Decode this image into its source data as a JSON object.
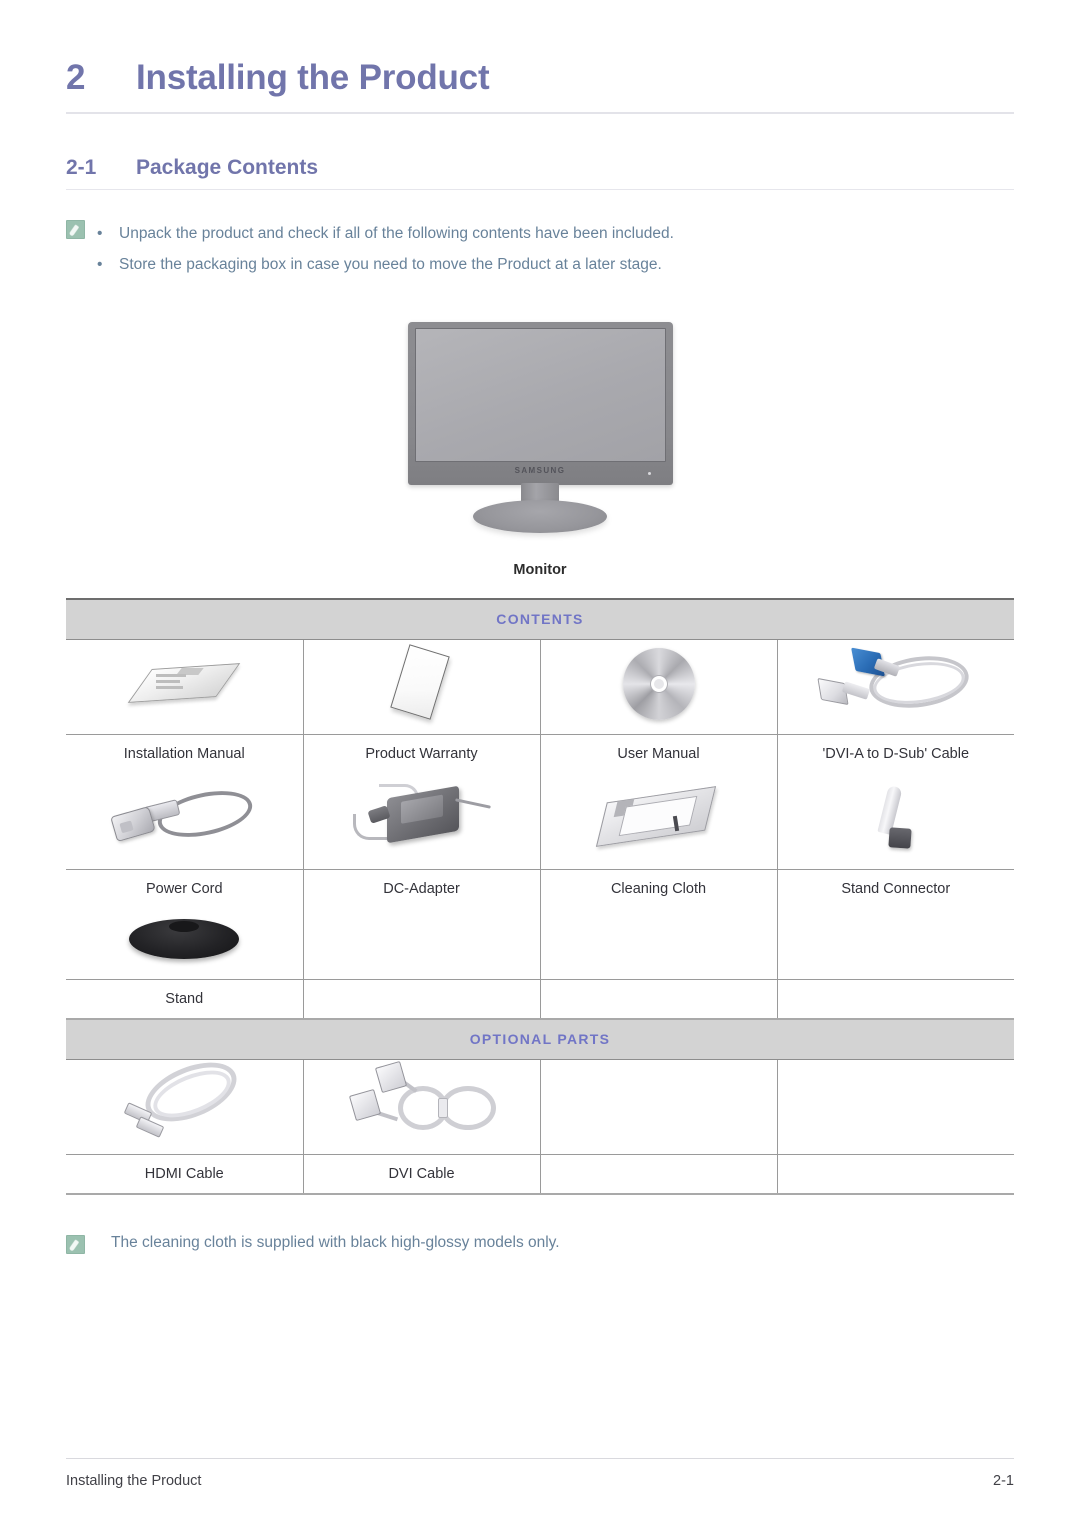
{
  "chapter": {
    "number": "2",
    "title": "Installing the Product"
  },
  "section": {
    "number": "2-1",
    "title": "Package Contents"
  },
  "notes": {
    "icon": "note-pencil-icon",
    "bullet": "•",
    "items": [
      "Unpack the product and check if all of the following contents have been included.",
      "Store the packaging box in case you need to move the Product at a later stage."
    ]
  },
  "figure": {
    "caption": "Monitor",
    "brand": "SAMSUNG",
    "alt": "monitor-illustration"
  },
  "table": {
    "contents_header": "CONTENTS",
    "optional_header": "OPTIONAL PARTS",
    "contents_rows": [
      [
        {
          "label": "Installation Manual",
          "icon": "installation-manual-icon"
        },
        {
          "label": "Product Warranty",
          "icon": "product-warranty-icon"
        },
        {
          "label": "User Manual",
          "icon": "user-manual-cd-icon"
        },
        {
          "label": "'DVI-A to D-Sub' Cable",
          "icon": "dvi-a-to-d-sub-cable-icon"
        }
      ],
      [
        {
          "label": "Power Cord",
          "icon": "power-cord-icon"
        },
        {
          "label": "DC-Adapter",
          "icon": "dc-adapter-icon"
        },
        {
          "label": "Cleaning Cloth",
          "icon": "cleaning-cloth-icon"
        },
        {
          "label": "Stand Connector",
          "icon": "stand-connector-icon"
        }
      ],
      [
        {
          "label": "Stand",
          "icon": "stand-base-icon"
        },
        {
          "label": "",
          "icon": ""
        },
        {
          "label": "",
          "icon": ""
        },
        {
          "label": "",
          "icon": ""
        }
      ]
    ],
    "optional_rows": [
      [
        {
          "label": "HDMI Cable",
          "icon": "hdmi-cable-icon"
        },
        {
          "label": "DVI Cable",
          "icon": "dvi-cable-icon"
        },
        {
          "label": "",
          "icon": ""
        },
        {
          "label": "",
          "icon": ""
        }
      ]
    ]
  },
  "footnote": {
    "icon": "note-pencil-icon",
    "text": "The cleaning cloth is supplied with black high-glossy models only."
  },
  "footer": {
    "left": "Installing the Product",
    "right": "2-1"
  },
  "colors": {
    "heading": "#7175ab",
    "table_header_text": "#7175c6",
    "table_header_bg": "#d3d3d3",
    "note_text": "#68829a",
    "note_icon_bg": "#9bc1b0",
    "body_text": "#33333a"
  }
}
